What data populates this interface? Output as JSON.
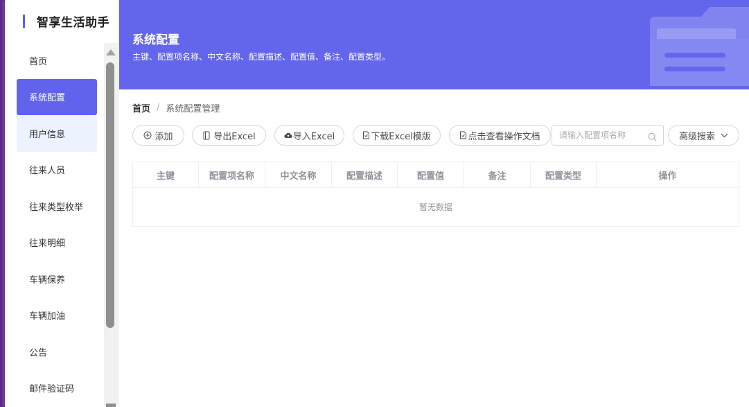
{
  "app": {
    "title": "智享生活助手"
  },
  "sidebar": {
    "items": [
      {
        "label": "首页",
        "state": "normal"
      },
      {
        "label": "系统配置",
        "state": "active"
      },
      {
        "label": "用户信息",
        "state": "hover"
      },
      {
        "label": "往来人员",
        "state": "normal"
      },
      {
        "label": "往来类型枚举",
        "state": "normal"
      },
      {
        "label": "往来明细",
        "state": "normal"
      },
      {
        "label": "车辆保养",
        "state": "normal"
      },
      {
        "label": "车辆加油",
        "state": "normal"
      },
      {
        "label": "公告",
        "state": "normal"
      },
      {
        "label": "邮件验证码",
        "state": "normal"
      }
    ]
  },
  "banner": {
    "title": "系统配置",
    "description": "主键、配置项名称、中文名称、配置描述、配置值、备注、配置类型。",
    "icon": "folder-icon"
  },
  "breadcrumb": {
    "home": "首页",
    "separator": "/",
    "current": "系统配置管理"
  },
  "toolbar": {
    "add_label": "添加",
    "export_label": "导出Excel",
    "import_label": "导入Excel",
    "download_template_label": "下载Excel模版",
    "docs_label": "点击查看操作文档",
    "search_placeholder": "请输入配置项名称",
    "advanced_search_label": "高级搜索"
  },
  "table": {
    "columns": [
      "主键",
      "配置项名称",
      "中文名称",
      "配置描述",
      "配置值",
      "备注",
      "配置类型",
      "操作"
    ],
    "rows": [],
    "empty_text": "暂无数据"
  },
  "colors": {
    "accent": "#6063ec",
    "banner_bg": "#6365ec",
    "hover_bg": "#ecf2fe"
  }
}
